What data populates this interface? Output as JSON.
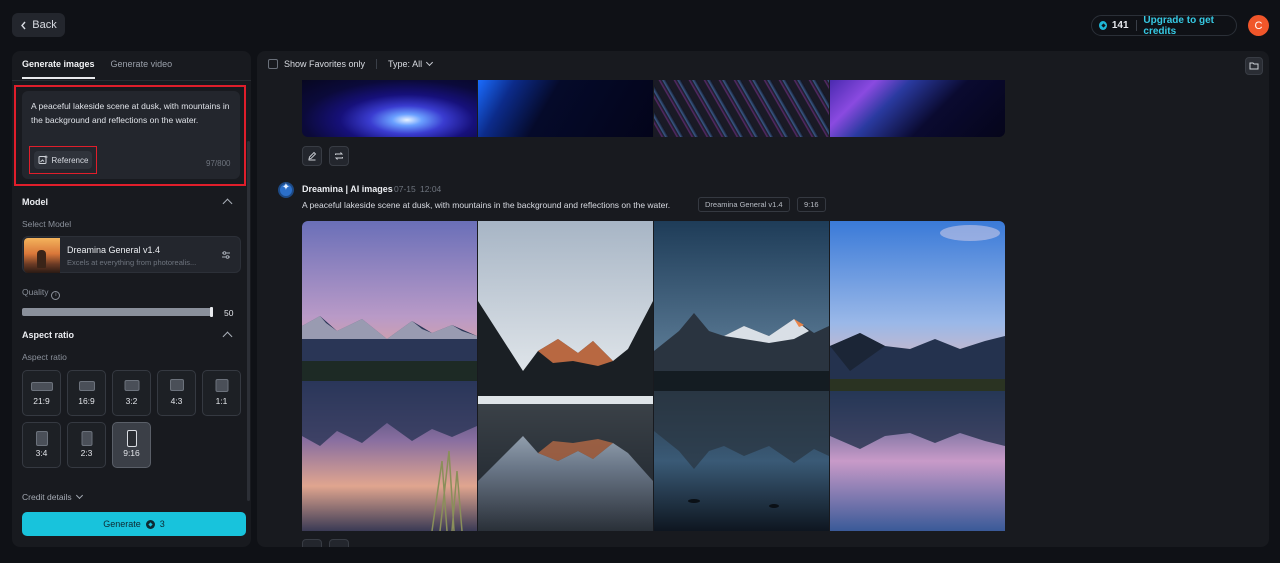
{
  "header": {
    "back_label": "Back",
    "credits_count": "141",
    "upgrade_label": "Upgrade to get credits",
    "avatar_initial": "C"
  },
  "left_panel": {
    "tabs": [
      {
        "label": "Generate images",
        "active": true
      },
      {
        "label": "Generate video",
        "active": false
      }
    ],
    "prompt": {
      "text": "A peaceful lakeside scene at dusk, with mountains in the background and reflections on the water.",
      "reference_label": "Reference",
      "char_count": "97/800"
    },
    "model_section": {
      "title": "Model",
      "select_label": "Select Model",
      "model_name": "Dreamina General v1.4",
      "model_desc": "Excels at everything from photorealis..."
    },
    "quality": {
      "label": "Quality",
      "value": "50",
      "fill_fraction": 0.5
    },
    "aspect_section": {
      "title": "Aspect ratio",
      "sub_label": "Aspect ratio",
      "options": [
        "21:9",
        "16:9",
        "3:2",
        "4:3",
        "1:1",
        "3:4",
        "2:3",
        "9:16"
      ],
      "selected": "9:16"
    },
    "credit_details_label": "Credit details",
    "generate": {
      "label": "Generate",
      "cost": "3"
    }
  },
  "right_panel": {
    "toolbar": {
      "favorites_label": "Show Favorites only",
      "type_label": "Type: All"
    },
    "message": {
      "author": "Dreamina | AI images",
      "date": "07-15",
      "time": "12:04",
      "prompt": "A peaceful lakeside scene at dusk, with mountains in the background and reflections on the water.",
      "model_chip": "Dreamina General v1.4",
      "ratio_chip": "9:16"
    }
  },
  "colors": {
    "accent": "#18c3dc",
    "highlight_outline": "#e01e2b",
    "avatar": "#f0562a",
    "background": "#0f1116",
    "panel": "#181a1f"
  }
}
